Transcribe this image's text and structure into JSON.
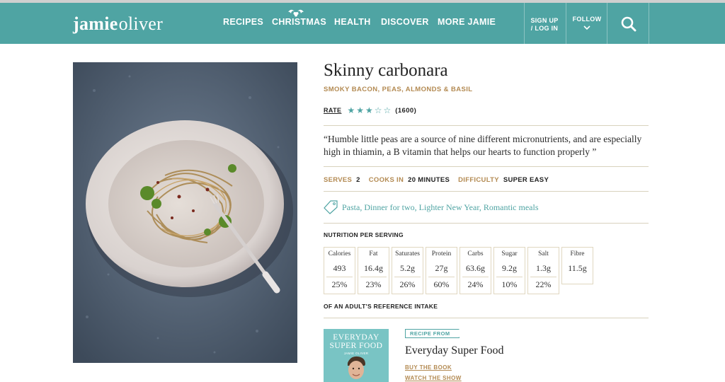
{
  "colors": {
    "brand_teal": "#4fa4a3",
    "gold_label": "#b38a52",
    "rule": "#d8d2bd"
  },
  "header": {
    "logo_part1": "jamie",
    "logo_part2": "oliver",
    "nav": [
      {
        "label": "RECIPES"
      },
      {
        "label": "CHRISTMAS"
      },
      {
        "label": "HEALTH"
      },
      {
        "label": "DISCOVER"
      },
      {
        "label": "MORE JAMIE"
      }
    ],
    "signup_line1": "SIGN UP",
    "signup_line2": "/ LOG IN",
    "follow": "FOLLOW",
    "search_icon": "search-icon"
  },
  "recipe": {
    "title": "Skinny carbonara",
    "subtitle": "SMOKY BACON, PEAS, ALMONDS & BASIL",
    "rate_label": "RATE",
    "rating": {
      "filled": 3,
      "max": 5
    },
    "rate_count": "(1600)",
    "quote": "“Humble little peas are a source of nine different micronutrients, and are especially high in thiamin, a B vitamin that helps our hearts to function properly ”",
    "serves_label": "SERVES",
    "serves_value": "2",
    "cooks_label": "COOKS IN",
    "cooks_value": "20 MINUTES",
    "difficulty_label": "DIFFICULTY",
    "difficulty_value": "SUPER EASY",
    "tags": [
      "Pasta",
      "Dinner for two",
      "Lighter New Year",
      "Romantic meals"
    ]
  },
  "nutrition": {
    "title": "NUTRITION PER SERVING",
    "items": [
      {
        "name": "Calories",
        "value": "493",
        "percent": "25%"
      },
      {
        "name": "Fat",
        "value": "16.4g",
        "percent": "23%"
      },
      {
        "name": "Saturates",
        "value": "5.2g",
        "percent": "26%"
      },
      {
        "name": "Protein",
        "value": "27g",
        "percent": "60%"
      },
      {
        "name": "Carbs",
        "value": "63.6g",
        "percent": "24%"
      },
      {
        "name": "Sugar",
        "value": "9.2g",
        "percent": "10%"
      },
      {
        "name": "Salt",
        "value": "1.3g",
        "percent": "22%"
      },
      {
        "name": "Fibre",
        "value": "11.5g",
        "percent": ""
      }
    ],
    "footer": "OF AN ADULT'S REFERENCE INTAKE"
  },
  "book": {
    "cover_line1": "EVERYDAY",
    "cover_line2": "SUPER FOOD",
    "cover_author": "JAMIE OLIVER",
    "recipe_from": "RECIPE FROM",
    "title": "Everyday Super Food",
    "buy_label": "BUY THE BOOK",
    "watch_label": "WATCH THE SHOW"
  }
}
